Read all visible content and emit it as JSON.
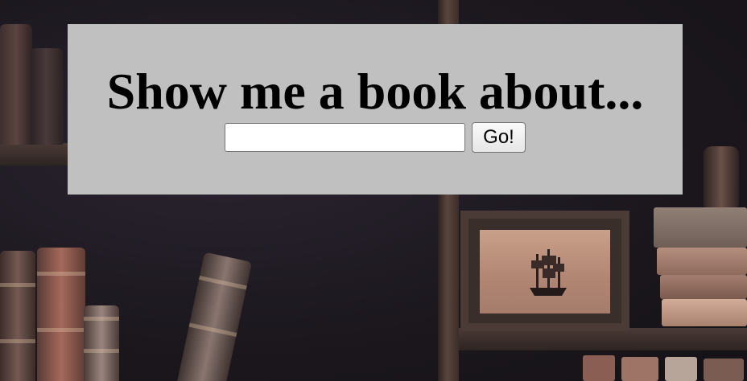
{
  "page": {
    "background_image": "bookshelf-photo"
  },
  "panel": {
    "heading": "Show me a book about...",
    "background_color": "#c0c0c0"
  },
  "search": {
    "value": "",
    "placeholder": ""
  },
  "submit": {
    "label": "Go!"
  }
}
